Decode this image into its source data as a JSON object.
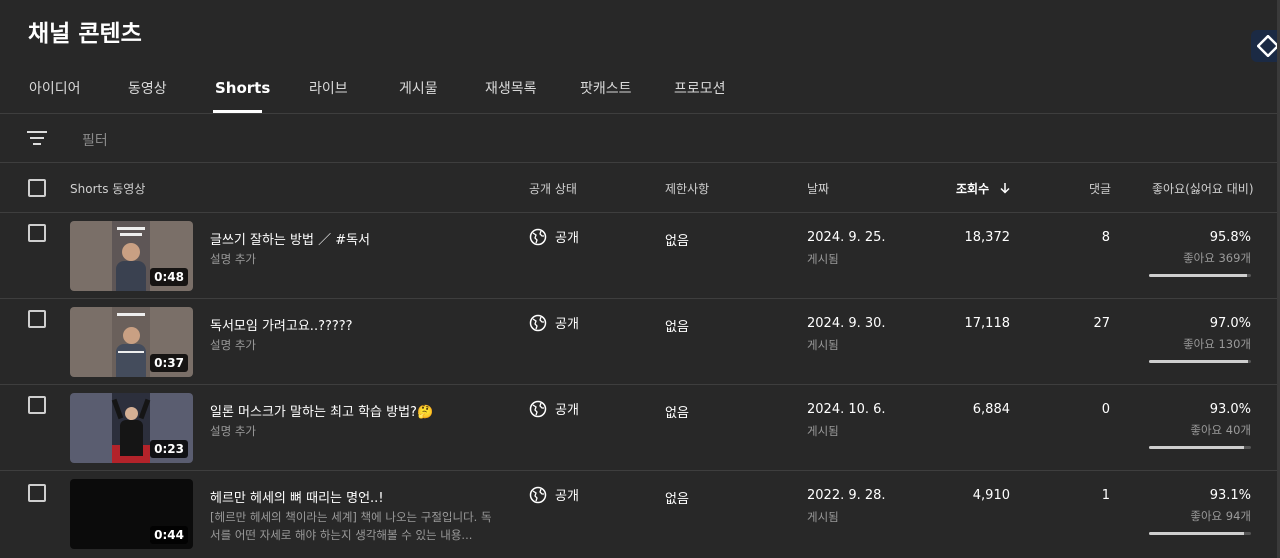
{
  "header": {
    "title": "채널 콘텐츠"
  },
  "tabs": [
    {
      "label": "아이디어"
    },
    {
      "label": "동영상"
    },
    {
      "label": "Shorts"
    },
    {
      "label": "라이브"
    },
    {
      "label": "게시물"
    },
    {
      "label": "재생목록"
    },
    {
      "label": "팟캐스트"
    },
    {
      "label": "프로모션"
    }
  ],
  "active_tab": "Shorts",
  "filter": {
    "placeholder": "필터"
  },
  "columns": {
    "video": "Shorts 동영상",
    "visibility": "공개 상태",
    "restrictions": "제한사항",
    "date": "날짜",
    "views": "조회수",
    "comments": "댓글",
    "likes": "좋아요(싫어요 대비)"
  },
  "rows": [
    {
      "title": "글쓰기 잘하는 방법 ／ #독서",
      "description": "설명 추가",
      "duration": "0:48",
      "visibility": "공개",
      "restriction": "없음",
      "date": "2024. 9. 25.",
      "date_status": "게시됨",
      "views": "18,372",
      "comments": "8",
      "like_pct": "95.8%",
      "like_count": "좋아요 369개",
      "like_ratio": 0.958
    },
    {
      "title": "독서모임 가려고요..?????",
      "description": "설명 추가",
      "duration": "0:37",
      "visibility": "공개",
      "restriction": "없음",
      "date": "2024. 9. 30.",
      "date_status": "게시됨",
      "views": "17,118",
      "comments": "27",
      "like_pct": "97.0%",
      "like_count": "좋아요 130개",
      "like_ratio": 0.97
    },
    {
      "title": "일론 머스크가 말하는 최고 학습 방법?🤔",
      "description": "설명 추가",
      "duration": "0:23",
      "visibility": "공개",
      "restriction": "없음",
      "date": "2024. 10. 6.",
      "date_status": "게시됨",
      "views": "6,884",
      "comments": "0",
      "like_pct": "93.0%",
      "like_count": "좋아요 40개",
      "like_ratio": 0.93
    },
    {
      "title": "헤르만 헤세의 뼈 때리는 명언..!",
      "description": "[헤르만 헤세의 책이라는 세계] 책에 나오는 구절입니다. 독서를 어떤 자세로 해야 하는지 생각해볼 수 있는 내용...",
      "duration": "0:44",
      "visibility": "공개",
      "restriction": "없음",
      "date": "2022. 9. 28.",
      "date_status": "게시됨",
      "views": "4,910",
      "comments": "1",
      "like_pct": "93.1%",
      "like_count": "좋아요 94개",
      "like_ratio": 0.931
    }
  ],
  "icons": {
    "filter": "filter-lines-icon",
    "sort": "arrow-down-icon",
    "visibility": "globe-icon",
    "extension": "diamond-extension-icon"
  }
}
